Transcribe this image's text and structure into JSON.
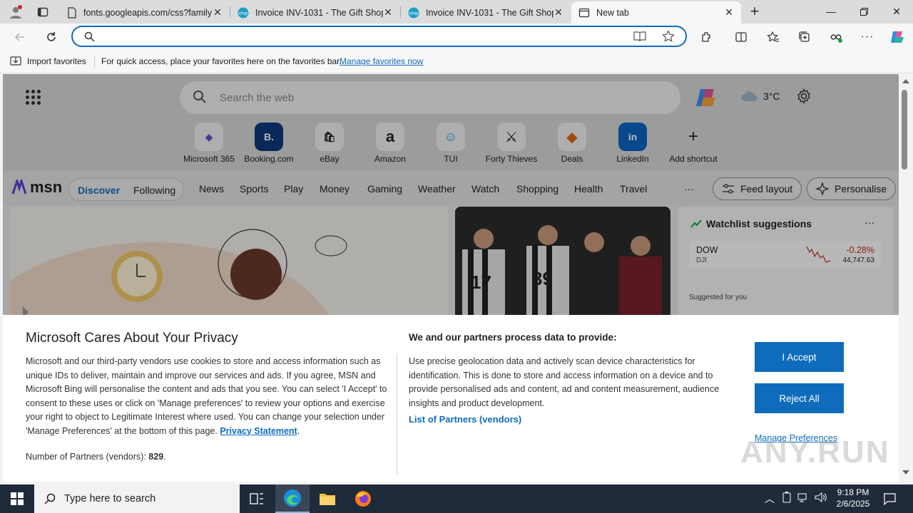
{
  "browser": {
    "tabs": [
      {
        "title": "fonts.googleapis.com/css?family"
      },
      {
        "title": "Invoice INV-1031 - The Gift Shop"
      },
      {
        "title": "Invoice INV-1031 - The Gift Shop"
      },
      {
        "title": "New tab"
      }
    ],
    "address_value": "",
    "favorites_bar": {
      "import_label": "Import favorites",
      "message": "For quick access, place your favorites here on the favorites bar.",
      "manage_link": "Manage favorites now"
    }
  },
  "newtab": {
    "search_placeholder": "Search the web",
    "weather_temp": "3°C",
    "shortcuts": [
      {
        "label": "Microsoft 365",
        "icon": "ms365-icon",
        "glyph": "◆"
      },
      {
        "label": "Booking.com",
        "icon": "booking-icon",
        "glyph": "B."
      },
      {
        "label": "eBay",
        "icon": "ebay-icon",
        "glyph": "🛍"
      },
      {
        "label": "Amazon",
        "icon": "amazon-icon",
        "glyph": "a"
      },
      {
        "label": "TUI",
        "icon": "tui-icon",
        "glyph": "☺"
      },
      {
        "label": "Forty Thieves",
        "icon": "forty-thieves-icon",
        "glyph": "⚔"
      },
      {
        "label": "Deals",
        "icon": "deals-icon",
        "glyph": "◆"
      },
      {
        "label": "LinkedIn",
        "icon": "linkedin-icon",
        "glyph": "in"
      },
      {
        "label": "Add shortcut",
        "icon": "plus-icon",
        "glyph": "+"
      }
    ],
    "msn_logo": "msn",
    "feed_toggle": {
      "discover": "Discover",
      "following": "Following"
    },
    "nav_links": [
      "News",
      "Sports",
      "Play",
      "Money",
      "Gaming",
      "Weather",
      "Watch",
      "Shopping",
      "Health",
      "Travel"
    ],
    "more": "···",
    "feed_layout": "Feed layout",
    "personalise": "Personalise",
    "watchlist": {
      "title": "Watchlist suggestions",
      "more": "···",
      "stock": {
        "symbol": "DOW",
        "sub": "DJI",
        "change": "-0.28%",
        "price": "44,747.63"
      },
      "suggested": "Suggested for you"
    }
  },
  "privacy": {
    "title": "Microsoft Cares About Your Privacy",
    "body": "Microsoft and our third-party vendors use cookies to store and access information such as unique IDs to deliver, maintain and improve our services and ads. If you agree, MSN and Microsoft Bing will personalise the content and ads that you see. You can select 'I Accept' to consent to these uses or click on 'Manage preferences' to review your options and exercise your right to object to Legitimate Interest where used.  You can change your selection under 'Manage Preferences' at the bottom of this page.",
    "privacy_link": "Privacy Statement",
    "partners_label": "Number of Partners (vendors):",
    "partners_count": "829",
    "heading2": "We and our partners process data to provide:",
    "body2": "Use precise geolocation data and actively scan device characteristics for identification. This is done to store and access information on a device and to provide personalised ads and content, ad and content measurement, audience insights and product development.",
    "list_link": "List of Partners (vendors)",
    "accept": "I Accept",
    "reject": "Reject All",
    "manage": "Manage Preferences"
  },
  "watermark": "ANY.RUN",
  "taskbar": {
    "search_placeholder": "Type here to search",
    "time": "9:18 PM",
    "date": "2/6/2025"
  },
  "colors": {
    "accent": "#0f6cbd",
    "negative": "#c42b1c",
    "taskbar": "#1f2a3a"
  }
}
